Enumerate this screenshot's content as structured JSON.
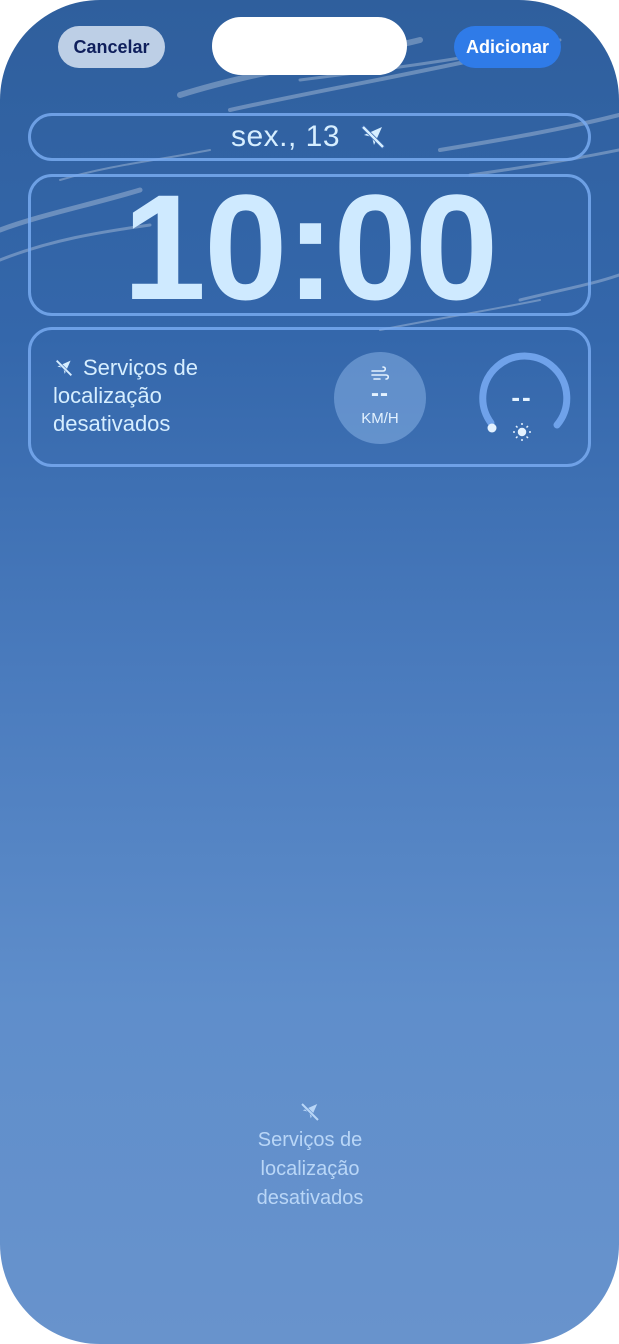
{
  "header": {
    "cancel_label": "Cancelar",
    "add_label": "Adicionar"
  },
  "lock_screen": {
    "date": "sex., 13",
    "date_icon": "location-off-icon",
    "time": "10:00"
  },
  "widgets": {
    "location": {
      "icon": "location-off-icon",
      "line1": "Serviços de",
      "line2": "localização",
      "line3": "desativados"
    },
    "wind": {
      "icon": "wind-icon",
      "value": "--",
      "unit": "KM/H"
    },
    "uv": {
      "icon": "sun-icon",
      "value": "--"
    }
  },
  "bottom_message": {
    "icon": "location-off-icon",
    "line1": "Serviços de",
    "line2": "localização",
    "line3": "desativados"
  },
  "colors": {
    "accent": "#2f7be8",
    "widget_border": "#78aaf0",
    "text_light": "#d6eeff"
  }
}
